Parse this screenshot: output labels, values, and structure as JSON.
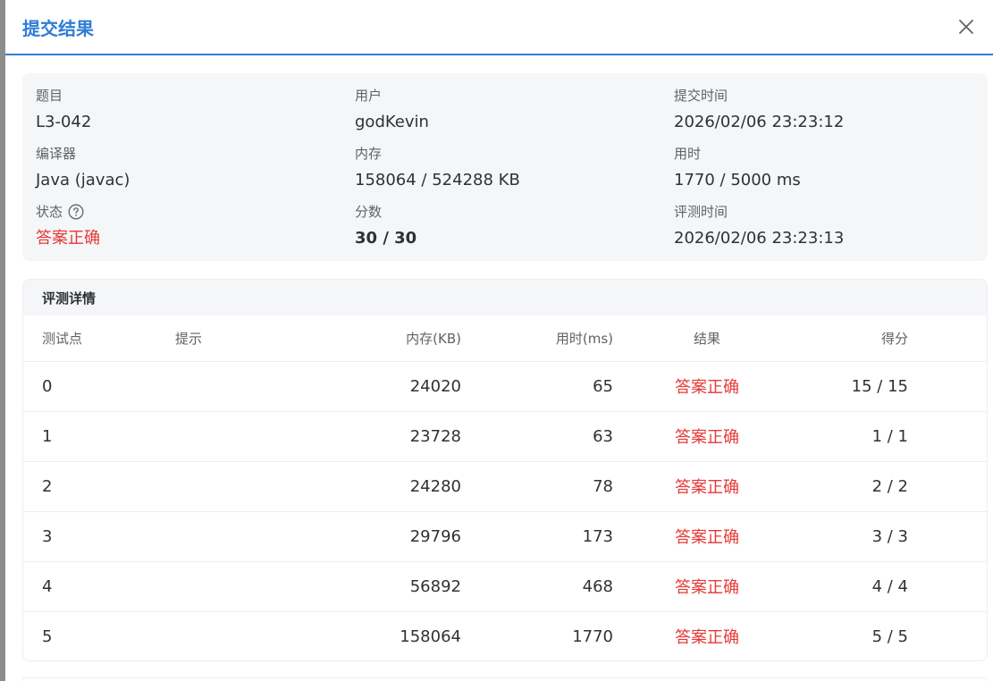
{
  "dialog": {
    "title": "提交结果"
  },
  "info": {
    "problem_label": "题目",
    "problem_value": "L3-042",
    "user_label": "用户",
    "user_value": "godKevin",
    "submit_time_label": "提交时间",
    "submit_time_value": "2026/02/06 23:23:12",
    "compiler_label": "编译器",
    "compiler_value": "Java (javac)",
    "memory_label": "内存",
    "memory_value": "158064 / 524288 KB",
    "time_label": "用时",
    "time_value": "1770 / 5000 ms",
    "status_label": "状态",
    "status_value": "答案正确",
    "score_label": "分数",
    "score_value": "30 / 30",
    "judge_time_label": "评测时间",
    "judge_time_value": "2026/02/06 23:23:13"
  },
  "details": {
    "title": "评测详情",
    "columns": {
      "case": "测试点",
      "hint": "提示",
      "memory": "内存(KB)",
      "time": "用时(ms)",
      "result": "结果",
      "score": "得分"
    },
    "rows": [
      {
        "case": "0",
        "hint": "",
        "memory": "24020",
        "time": "65",
        "result": "答案正确",
        "score": "15 / 15"
      },
      {
        "case": "1",
        "hint": "",
        "memory": "23728",
        "time": "63",
        "result": "答案正确",
        "score": "1 / 1"
      },
      {
        "case": "2",
        "hint": "",
        "memory": "24280",
        "time": "78",
        "result": "答案正确",
        "score": "2 / 2"
      },
      {
        "case": "3",
        "hint": "",
        "memory": "29796",
        "time": "173",
        "result": "答案正确",
        "score": "3 / 3"
      },
      {
        "case": "4",
        "hint": "",
        "memory": "56892",
        "time": "468",
        "result": "答案正确",
        "score": "4 / 4"
      },
      {
        "case": "5",
        "hint": "",
        "memory": "158064",
        "time": "1770",
        "result": "答案正确",
        "score": "5 / 5"
      }
    ]
  },
  "colors": {
    "accent": "#2f7dd6",
    "accepted": "#e53935",
    "card_bg": "#f5f6f8"
  },
  "icons": {
    "close": "close-icon",
    "help": "question-circle-icon"
  }
}
